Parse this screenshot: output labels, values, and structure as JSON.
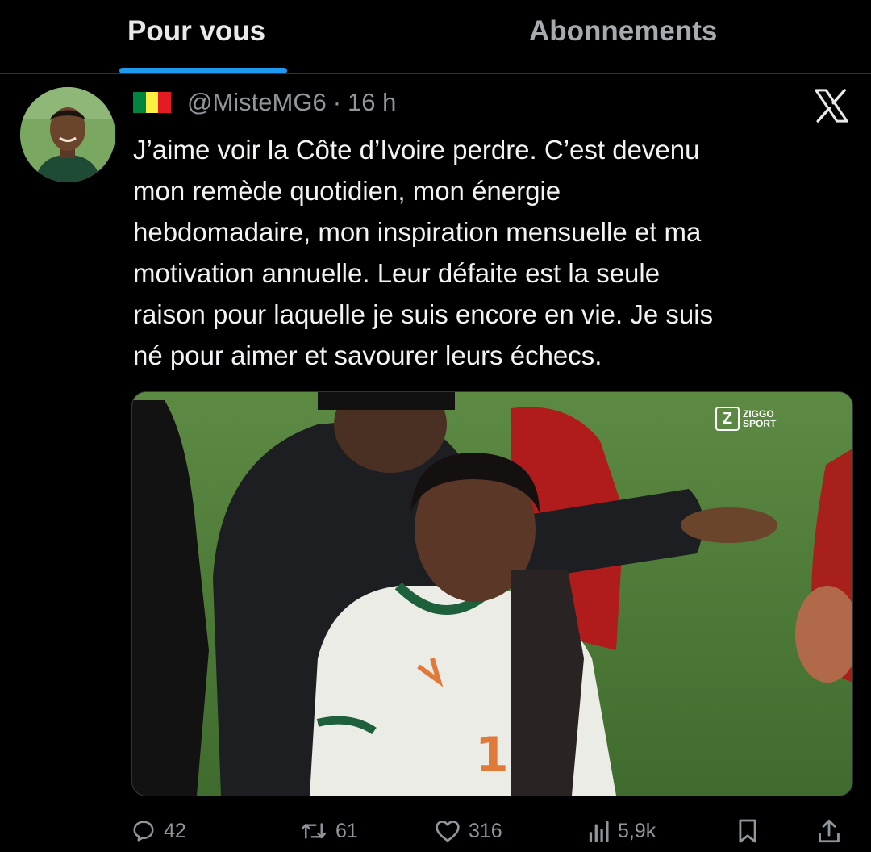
{
  "tabs": [
    {
      "label": "Pour vous",
      "active": true
    },
    {
      "label": "Abonnements",
      "active": false
    }
  ],
  "colors": {
    "accent": "#1d9bf0",
    "background": "#000000",
    "muted": "#8f969c",
    "text": "#e7e9ea"
  },
  "tweet": {
    "handle": "@MisteMG6",
    "separator": "·",
    "time": "16 h",
    "flag": {
      "name": "senegal-flag",
      "colors": [
        "#00853f",
        "#fdef42",
        "#e31b23"
      ]
    },
    "platform_icon": "x-logo-icon",
    "text_lines": [
      "J’aime voir la Côte d’Ivoire perdre. C’est devenu",
      "mon remède quotidien, mon énergie",
      "hebdomadaire, mon inspiration mensuelle et ma",
      "motivation annuelle. Leur défaite est la seule",
      "raison pour laquelle je suis encore en vie. Je suis",
      "né pour aimer et savourer leurs échecs."
    ],
    "media": {
      "watermark_letter": "Z",
      "watermark_text": "ZIGGO\nSPORT",
      "jersey_number": "1"
    },
    "actions": {
      "reply": {
        "icon": "reply-icon",
        "count": "42"
      },
      "repost": {
        "icon": "repost-icon",
        "count": "61"
      },
      "like": {
        "icon": "heart-icon",
        "count": "316"
      },
      "views": {
        "icon": "views-icon",
        "count": "5,9k"
      },
      "bookmark": {
        "icon": "bookmark-icon"
      },
      "share": {
        "icon": "share-icon"
      }
    }
  }
}
